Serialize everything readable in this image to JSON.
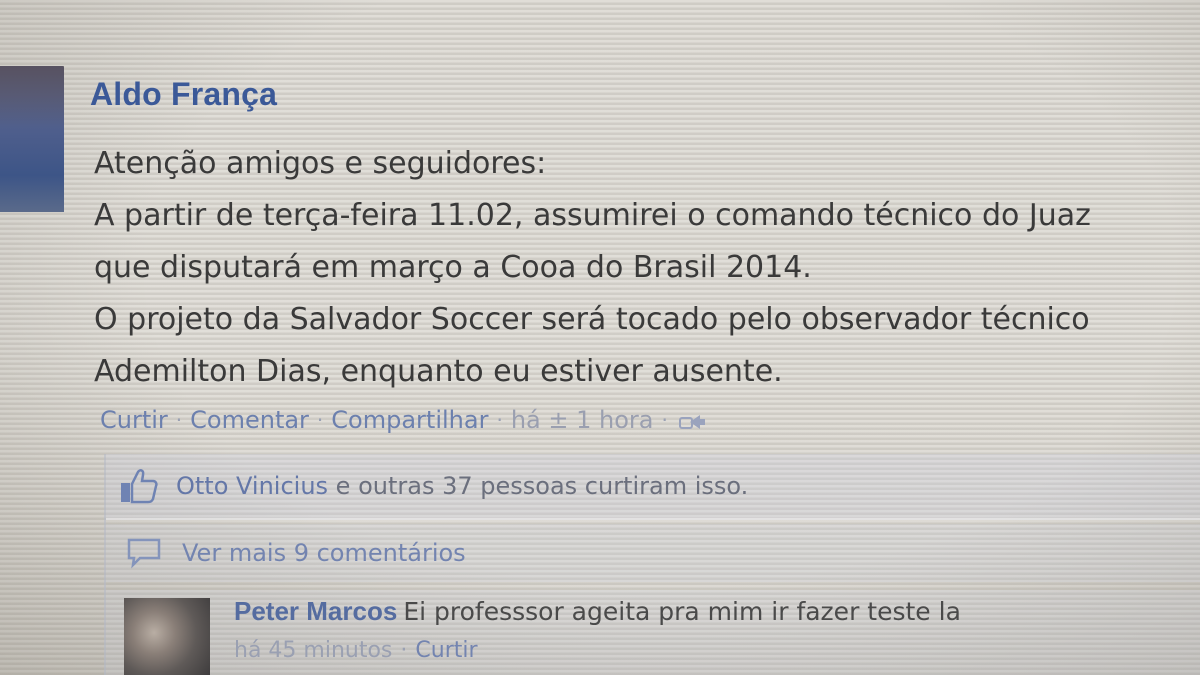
{
  "post": {
    "author": "Aldo França",
    "lines": [
      "Atenção amigos e seguidores:",
      "A partir de terça-feira 11.02, assumirei o comando técnico do Juaz",
      "que disputará em março a Cooa do Brasil 2014.",
      "O projeto da Salvador Soccer será tocado pelo observador técnico",
      "Ademilton Dias, enquanto eu estiver ausente."
    ]
  },
  "actions": {
    "like": "Curtir",
    "comment": "Comentar",
    "share": "Compartilhar",
    "time": "há ± 1 hora",
    "separator": "·"
  },
  "likes": {
    "names": "Otto Vinicius",
    "rest": " e outras 37 pessoas curtiram isso."
  },
  "more_comments": "Ver mais 9 comentários",
  "comment": {
    "author": "Peter Marcos",
    "text": "Ei professsor ageita pra mim ir fazer teste la",
    "time": "há 45 minutos",
    "like": "Curtir",
    "separator": "·"
  },
  "colors": {
    "link_blue": "#3b5998",
    "muted_blue": "#6c80ae",
    "text": "#3a3a3a"
  },
  "icons": {
    "like": "thumbs-up-icon",
    "comment": "speech-bubble-icon",
    "share": "share-icon"
  }
}
